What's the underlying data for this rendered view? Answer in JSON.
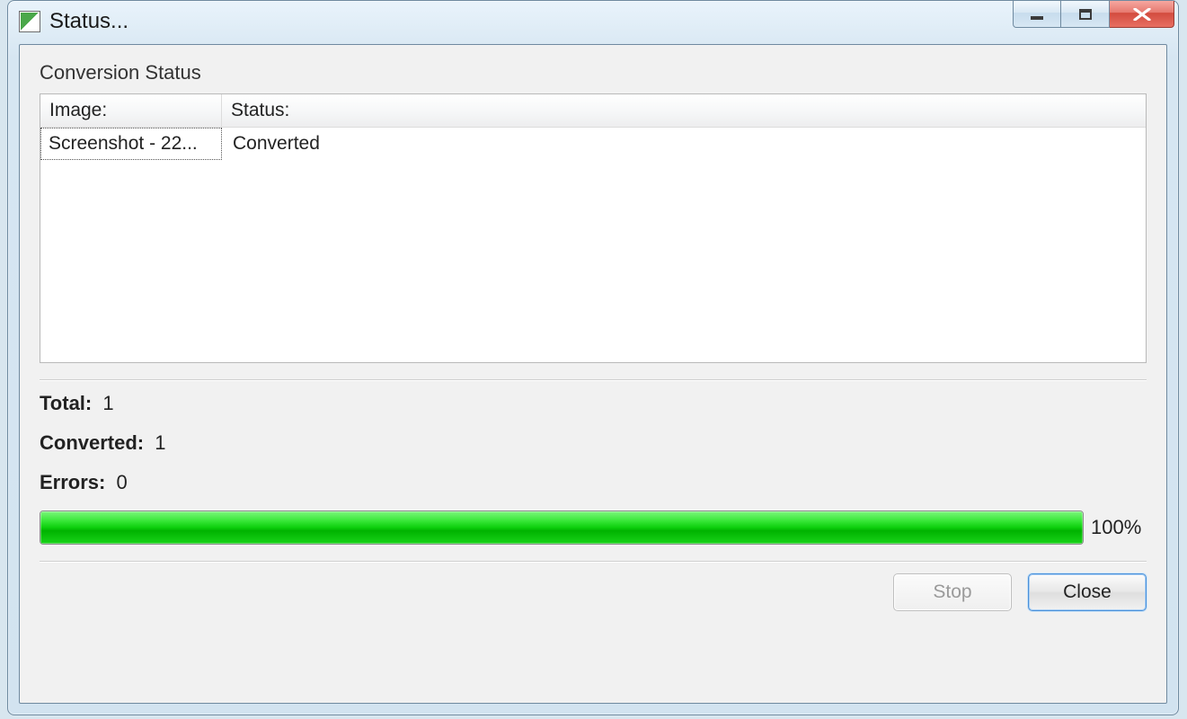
{
  "window": {
    "title": "Status..."
  },
  "section_label": "Conversion Status",
  "table": {
    "columns": {
      "image": "Image:",
      "status": "Status:"
    },
    "rows": [
      {
        "image": "Screenshot - 22...",
        "status": "Converted"
      }
    ]
  },
  "stats": {
    "total_label": "Total:",
    "total_value": "1",
    "converted_label": "Converted:",
    "converted_value": "1",
    "errors_label": "Errors:",
    "errors_value": "0"
  },
  "progress": {
    "percent": 100,
    "percent_text": "100%"
  },
  "buttons": {
    "stop": "Stop",
    "close": "Close"
  }
}
